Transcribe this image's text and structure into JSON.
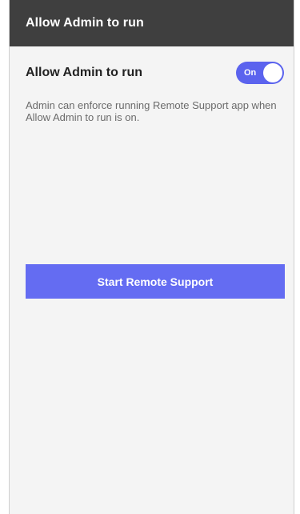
{
  "header": {
    "title": "Allow Admin to run"
  },
  "setting": {
    "label": "Allow Admin to run",
    "toggle_state_label": "On",
    "toggle_on": true,
    "description": "Admin can enforce running Remote Support app when Allow Admin to run is on."
  },
  "actions": {
    "start_button_label": "Start Remote Support"
  },
  "colors": {
    "header_bg": "#3f3f3f",
    "accent": "#5b63ee",
    "button_bg": "#646cf2",
    "page_bg": "#f4f4f4"
  }
}
